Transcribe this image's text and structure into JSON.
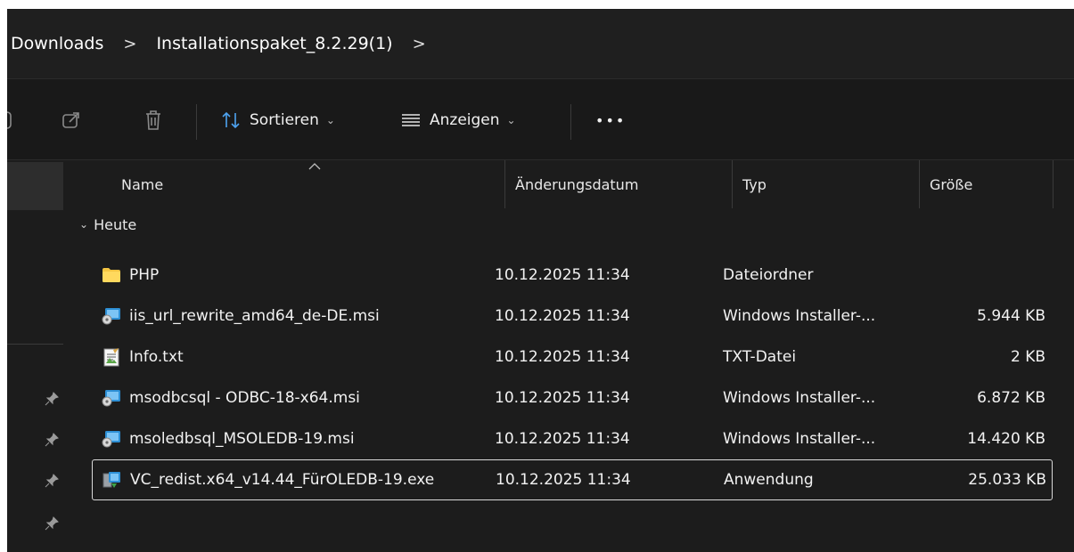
{
  "breadcrumb": {
    "items": [
      "Downloads",
      "Installationspaket_8.2.29(1)"
    ],
    "separator": ">"
  },
  "toolbar": {
    "share_icon": "share-icon",
    "delete_icon": "trash-icon",
    "sort_label": "Sortieren",
    "view_label": "Anzeigen",
    "more_label": "•••"
  },
  "columns": {
    "name": "Name",
    "date": "Änderungsdatum",
    "type": "Typ",
    "size": "Größe"
  },
  "group": {
    "label": "Heute"
  },
  "files": [
    {
      "icon": "folder-icon",
      "name": "PHP",
      "date": "10.12.2025 11:34",
      "type": "Dateiordner",
      "size": ""
    },
    {
      "icon": "msi-installer-icon",
      "name": "iis_url_rewrite_amd64_de-DE.msi",
      "date": "10.12.2025 11:34",
      "type": "Windows Installer-...",
      "size": "5.944 KB"
    },
    {
      "icon": "text-file-icon",
      "name": "Info.txt",
      "date": "10.12.2025 11:34",
      "type": "TXT-Datei",
      "size": "2 KB"
    },
    {
      "icon": "msi-installer-icon",
      "name": "msodbcsql - ODBC-18-x64.msi",
      "date": "10.12.2025 11:34",
      "type": "Windows Installer-...",
      "size": "6.872 KB"
    },
    {
      "icon": "msi-installer-icon",
      "name": "msoledbsql_MSOLEDB-19.msi",
      "date": "10.12.2025 11:34",
      "type": "Windows Installer-...",
      "size": "14.420 KB"
    },
    {
      "icon": "exe-installer-icon",
      "name": "VC_redist.x64_v14.44_FürOLEDB-19.exe",
      "date": "10.12.2025 11:34",
      "type": "Anwendung",
      "size": "25.033 KB"
    }
  ],
  "selected_index": 5,
  "colors": {
    "background": "#1c1c1c",
    "folder": "#f4c542",
    "msi": "#2d8fd5",
    "selection_border": "#d9d9d9"
  }
}
